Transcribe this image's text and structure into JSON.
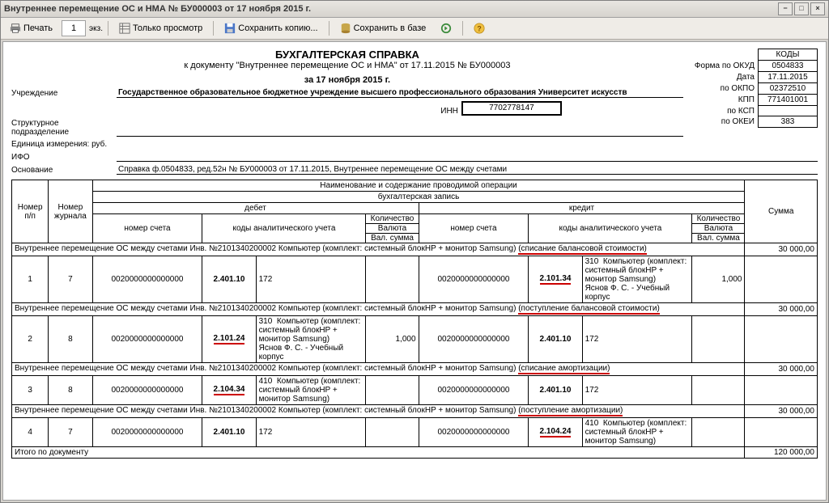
{
  "window": {
    "title": "Внутреннее перемещение ОС и НМА № БУ000003 от 17 ноября 2015 г."
  },
  "toolbar": {
    "print": "Печать",
    "copies": "1",
    "ekz": "экз.",
    "preview": "Только просмотр",
    "saveCopy": "Сохранить копию...",
    "saveDb": "Сохранить в базе"
  },
  "doc": {
    "title": "БУХГАЛТЕРСКАЯ СПРАВКА",
    "sub": "к документу \"Внутреннее перемещение ОС и НМА\" от 17.11.2015 № БУ000003",
    "dateLine": "за 17 ноября 2015 г.",
    "orgLabel": "Учреждение",
    "org": "Государственное образовательное бюджетное учреждение высшего профессионального образования  Университет искусств",
    "innLabel": "ИНН",
    "inn": "7702778147",
    "subdivLabel": "Структурное подразделение",
    "unitLabel": "Единица измерения: руб.",
    "ifoLabel": "ИФО",
    "basisLabel": "Основание",
    "basis": "Справка ф.0504833, ред.52н № БУ000003 от 17.11.2015, Внутреннее перемещение ОС между счетами"
  },
  "codes": {
    "head": "КОДЫ",
    "rows": [
      {
        "l": "Форма по ОКУД",
        "v": "0504833"
      },
      {
        "l": "Дата",
        "v": "17.11.2015"
      },
      {
        "l": "по ОКПО",
        "v": "02372510"
      },
      {
        "l": "КПП",
        "v": "771401001"
      },
      {
        "l": "по КСП",
        "v": ""
      },
      {
        "l": "по ОКЕИ",
        "v": "383"
      }
    ]
  },
  "headers": {
    "operation": "Наименование и содержание проводимой операции",
    "entry": "бухгалтерская запись",
    "numPP": "Номер п/п",
    "numJ": "Номер журнала",
    "debit": "дебет",
    "credit": "кредит",
    "sum": "Сумма",
    "account": "номер счета",
    "analytic": "коды аналитического учета",
    "qty": "Количество",
    "currency": "Валюта",
    "valSum": "Вал. сумма"
  },
  "sections": [
    {
      "title": "Внутреннее перемещение ОС между счетами Инв. №2101340200002 Компьютер (комплект: системный блокHP + монитор Samsung)",
      "tag": "(списание балансовой стоимости)",
      "sum": "30 000,00",
      "row": {
        "n": "1",
        "j": "7",
        "dAcc": "0020000000000000",
        "dA1": "2.401.10",
        "dA2": "172",
        "dNote": "",
        "cAcc": "0020000000000000",
        "cA1": "2.101.34",
        "cA2": "310",
        "cNote": "Компьютер (комплект: системный блокHP + монитор Samsung)\nЯснов Ф. С. - Учебный корпус",
        "cU": true,
        "qty": "1,000"
      }
    },
    {
      "title": "Внутреннее перемещение ОС между счетами Инв. №2101340200002 Компьютер (комплект: системный блокHP + монитор Samsung)",
      "tag": "(поступление балансовой стоимости)",
      "sum": "30 000,00",
      "row": {
        "n": "2",
        "j": "8",
        "dAcc": "0020000000000000",
        "dA1": "2.101.24",
        "dA2": "310",
        "dNote": "Компьютер (комплект: системный блокHP + монитор Samsung)\nЯснов Ф. С. - Учебный корпус",
        "dU": true,
        "cAcc": "0020000000000000",
        "cA1": "2.401.10",
        "cA2": "172",
        "cNote": "",
        "qty": "1,000",
        "qtyD": true
      }
    },
    {
      "title": "Внутреннее перемещение ОС между счетами Инв. №2101340200002 Компьютер (комплект: системный блокHP + монитор Samsung)",
      "tag": "(списание амортизации)",
      "sum": "30 000,00",
      "row": {
        "n": "3",
        "j": "8",
        "dAcc": "0020000000000000",
        "dA1": "2.104.34",
        "dA2": "410",
        "dNote": "Компьютер (комплект: системный блокHP + монитор Samsung)",
        "dU": true,
        "cAcc": "0020000000000000",
        "cA1": "2.401.10",
        "cA2": "172",
        "cNote": "",
        "qty": ""
      }
    },
    {
      "title": "Внутреннее перемещение ОС между счетами Инв. №2101340200002 Компьютер (комплект: системный блокHP + монитор Samsung)",
      "tag": "(поступление амортизации)",
      "sum": "30 000,00",
      "row": {
        "n": "4",
        "j": "7",
        "dAcc": "0020000000000000",
        "dA1": "2.401.10",
        "dA2": "172",
        "dNote": "",
        "cAcc": "0020000000000000",
        "cA1": "2.104.24",
        "cA2": "410",
        "cNote": "Компьютер (комплект: системный блокHP + монитор Samsung)",
        "cU": true,
        "qty": ""
      }
    }
  ],
  "footer": {
    "label": "Итого по документу",
    "total": "120 000,00"
  }
}
